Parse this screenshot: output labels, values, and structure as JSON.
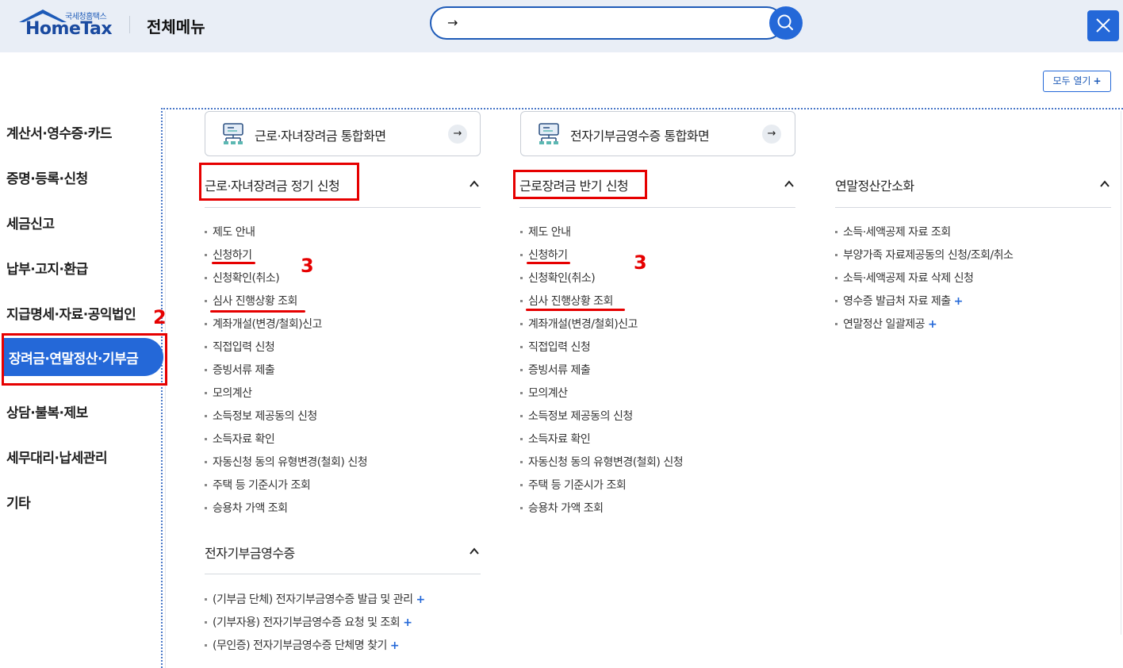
{
  "header": {
    "logo_small": "국세청홈택스",
    "logo_main": "HomeTax",
    "title": "전체메뉴",
    "search_arrow": "→"
  },
  "open_all": "모두 열기",
  "sidebar": {
    "items": [
      "계산서·영수증·카드",
      "증명·등록·신청",
      "세금신고",
      "납부·고지·환급",
      "지급명세·자료·공익법인",
      "장려금·연말정산·기부금",
      "상담·불복·제보",
      "세무대리·납세관리",
      "기타"
    ],
    "active_index": 5
  },
  "quick_cards": [
    {
      "label": "근로·자녀장려금 통합화면",
      "arrow": "→"
    },
    {
      "label": "전자기부금영수증 통합화면",
      "arrow": "→"
    }
  ],
  "sections": {
    "col1": {
      "title": "근로·자녀장려금 정기 신청",
      "items": [
        "제도 안내",
        "신청하기",
        "신청확인(취소)",
        "심사 진행상황 조회",
        "계좌개설(변경/철회)신고",
        "직접입력 신청",
        "증빙서류 제출",
        "모의계산",
        "소득정보 제공동의 신청",
        "소득자료 확인",
        "자동신청 동의 유형변경(철회) 신청",
        "주택 등 기준시가 조회",
        "승용차 가액 조회"
      ]
    },
    "col2": {
      "title": "근로장려금 반기 신청",
      "items": [
        "제도 안내",
        "신청하기",
        "신청확인(취소)",
        "심사 진행상황 조회",
        "계좌개설(변경/철회)신고",
        "직접입력 신청",
        "증빙서류 제출",
        "모의계산",
        "소득정보 제공동의 신청",
        "소득자료 확인",
        "자동신청 동의 유형변경(철회) 신청",
        "주택 등 기준시가 조회",
        "승용차 가액 조회"
      ]
    },
    "col3": {
      "title": "연말정산간소화",
      "items": [
        "소득·세액공제 자료 조회",
        "부양가족 자료제공동의 신청/조회/취소",
        "소득·세액공제 자료 삭제 신청",
        "영수증 발급처 자료 제출",
        "연말정산 일괄제공"
      ]
    },
    "col1b": {
      "title": "전자기부금영수증",
      "items": [
        "(기부금 단체) 전자기부금영수증 발급 및 관리",
        "(기부자용) 전자기부금영수증 요청 및 조회",
        "(무인증) 전자기부금영수증 단체명 찾기"
      ]
    }
  },
  "plus_symbol": "+",
  "annotations": {
    "sidebar_num": "2",
    "col1_num": "3",
    "col2_num": "3"
  },
  "colors": {
    "accent": "#2468d8",
    "annotation": "#e60000",
    "header_bg": "#e9eef6"
  }
}
